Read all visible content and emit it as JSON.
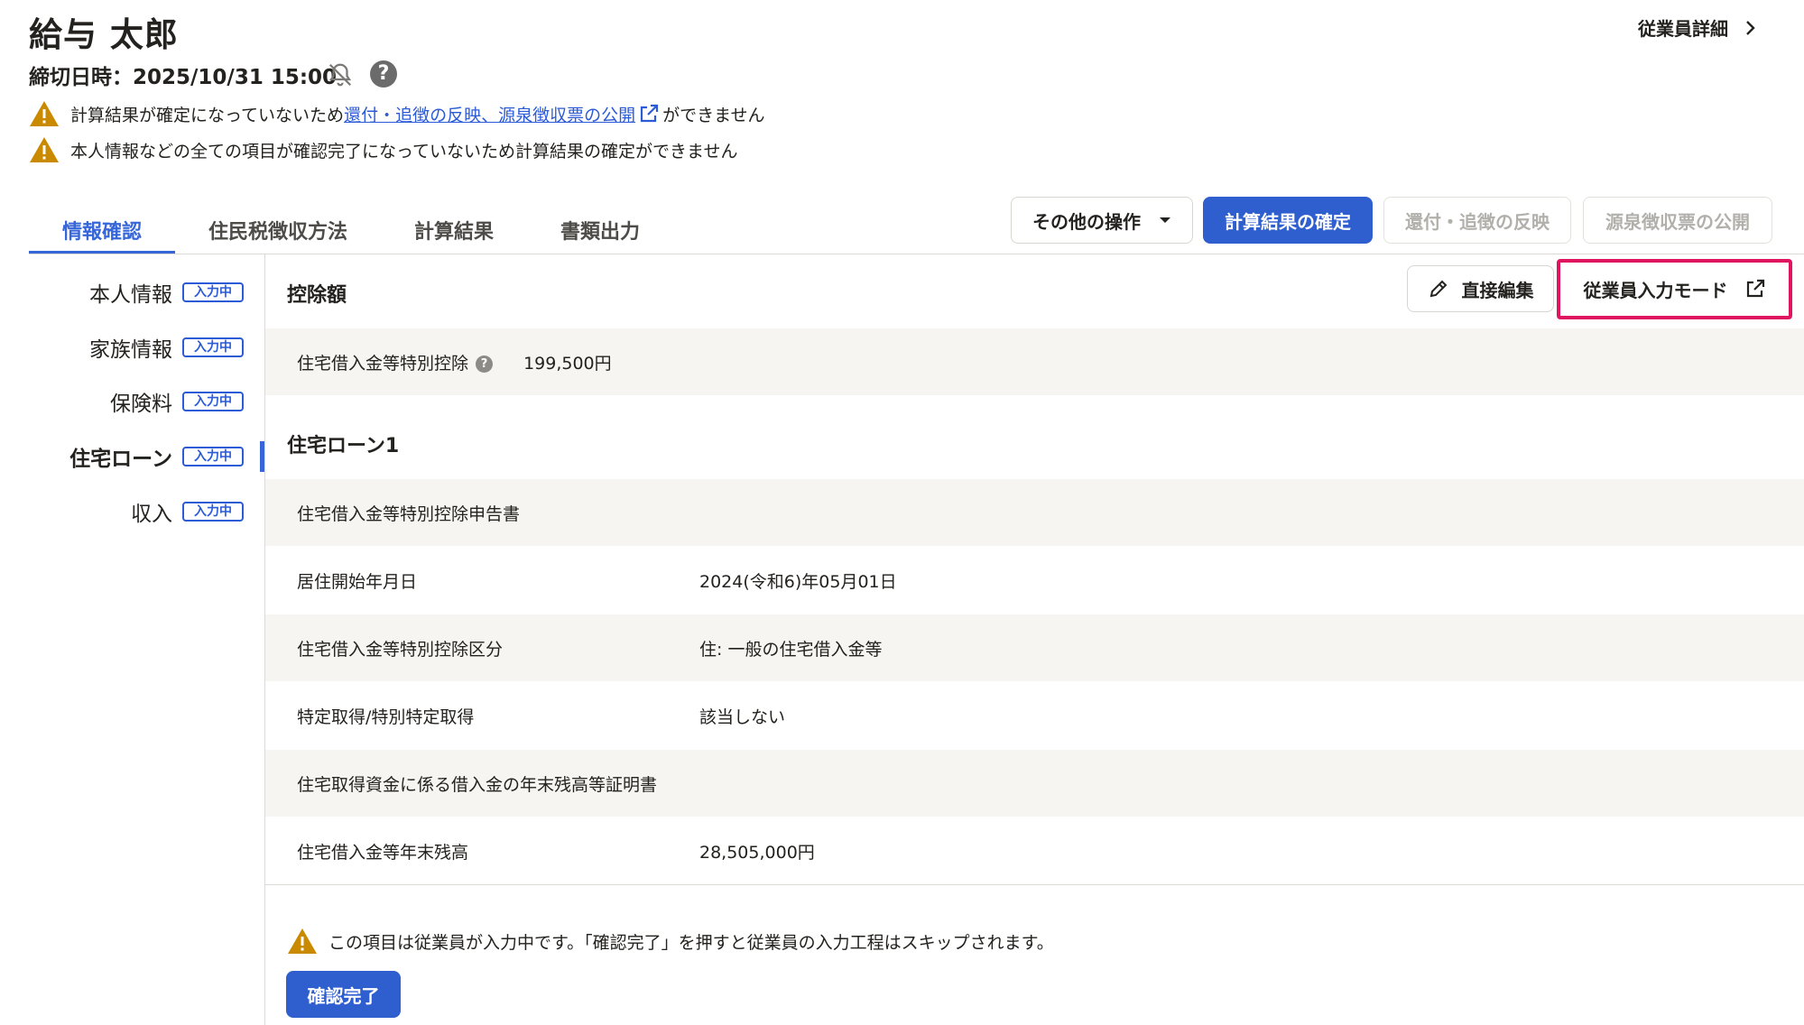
{
  "header": {
    "employee_name": "給与 太郎",
    "deadline": "締切日時：2025/10/31 15:00",
    "bell_icon": "bell-off-icon",
    "help_icon": "?",
    "employee_detail_link": "従業員詳細"
  },
  "warnings": [
    {
      "before": "計算結果が確定になっていないため",
      "link": "還付・追徴の反映、源泉徴収票の公開",
      "after": "ができません"
    },
    {
      "text": "本人情報などの全ての項目が確認完了になっていないため計算結果の確定ができません"
    }
  ],
  "tabs": [
    "情報確認",
    "住民税徴収方法",
    "計算結果",
    "書類出力"
  ],
  "actions": {
    "other_ops": "その他の操作",
    "confirm_calc": "計算結果の確定",
    "reflect_refund": "還付・追徴の反映",
    "publish_withholding": "源泉徴収票の公開"
  },
  "sidebar": {
    "items": [
      {
        "label": "本人情報",
        "badge": "入力中"
      },
      {
        "label": "家族情報",
        "badge": "入力中"
      },
      {
        "label": "保険料",
        "badge": "入力中"
      },
      {
        "label": "住宅ローン",
        "badge": "入力中"
      },
      {
        "label": "収入",
        "badge": "入力中"
      }
    ]
  },
  "main": {
    "deduction_title": "控除額",
    "direct_edit": "直接編集",
    "employee_input_mode": "従業員入力モード",
    "deduction_row": {
      "label": "住宅借入金等特別控除",
      "value": "199,500円"
    },
    "loan_title": "住宅ローン1",
    "rows": [
      {
        "label": "住宅借入金等特別控除申告書",
        "value": ""
      },
      {
        "label": "居住開始年月日",
        "value": "2024(令和6)年05月01日"
      },
      {
        "label": "住宅借入金等特別控除区分",
        "value": "住: 一般の住宅借入金等"
      },
      {
        "label": "特定取得/特別特定取得",
        "value": "該当しない"
      },
      {
        "label": "住宅取得資金に係る借入金の年末残高等証明書",
        "value": ""
      },
      {
        "label": "住宅借入金等年末残高",
        "value": "28,505,000円"
      }
    ],
    "footer_warning": "この項目は従業員が入力中です。「確認完了」を押すと従業員の入力工程はスキップされます。",
    "confirm_done": "確認完了"
  },
  "colors": {
    "accent": "#2f5fcf",
    "warning": "#c98a00",
    "highlight": "#e0155f"
  }
}
